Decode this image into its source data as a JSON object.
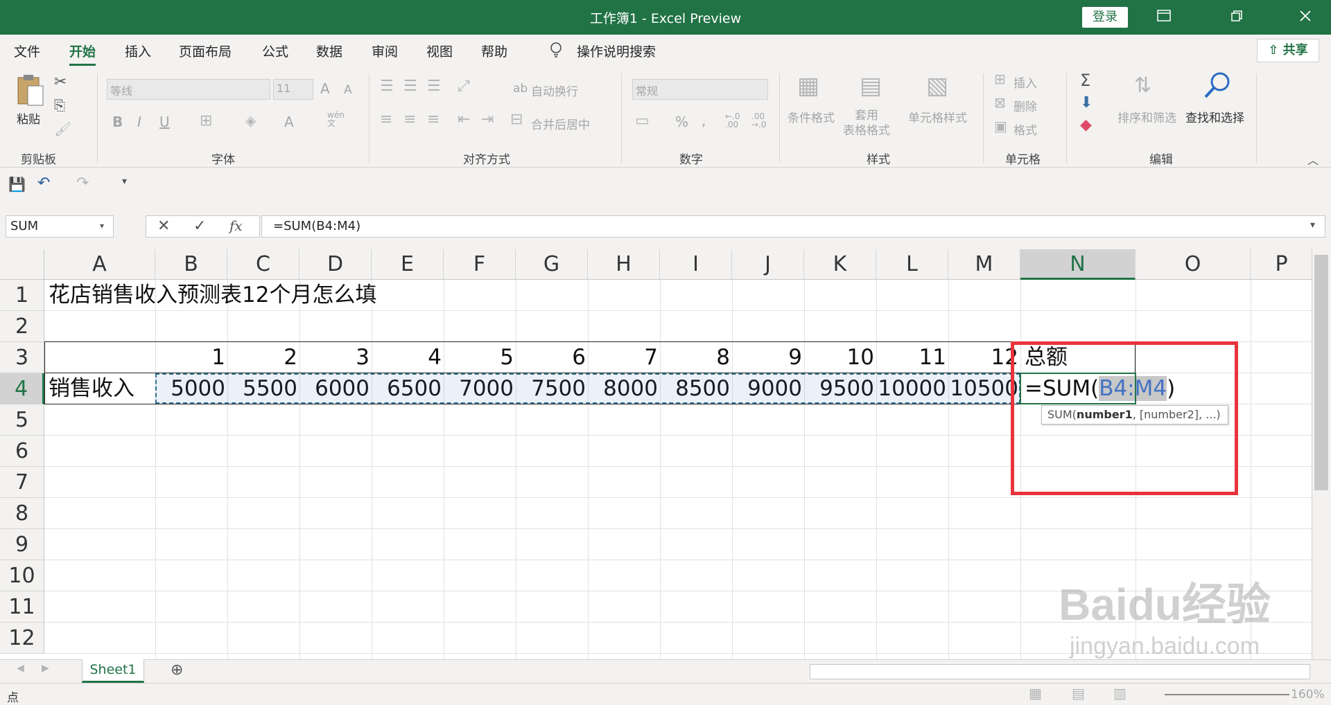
{
  "titlebar": {
    "title": "工作簿1  -  Excel Preview",
    "login": "登录",
    "ribbon_display_icon": "ribbon-display-icon",
    "restore_icon": "restore-icon",
    "close_icon": "close-icon"
  },
  "menu": {
    "tabs": [
      "文件",
      "开始",
      "插入",
      "页面布局",
      "公式",
      "数据",
      "审阅",
      "视图",
      "帮助"
    ],
    "active": "开始",
    "search": "操作说明搜索",
    "share": "共享"
  },
  "ribbon": {
    "clipboard": {
      "label": "剪贴板",
      "paste": "粘贴"
    },
    "font": {
      "label": "字体",
      "font_name": "等线",
      "font_size": "11",
      "bold": "B",
      "italic": "I",
      "underline": "U",
      "grow": "A",
      "shrink": "A",
      "wen": "wén\n文"
    },
    "alignment": {
      "label": "对齐方式",
      "wrap": "自动换行",
      "merge": "合并后居中"
    },
    "number": {
      "label": "数字",
      "format": "常规",
      "percent": "%",
      "comma": ",",
      "inc": "←.0\n.00",
      "dec": ".00\n→.0"
    },
    "styles": {
      "label": "样式",
      "conditional": "条件格式",
      "table": "套用\n表格格式",
      "cell_styles": "单元格样式"
    },
    "cells": {
      "label": "单元格",
      "insert": "插入",
      "delete": "删除",
      "format": "格式"
    },
    "editing": {
      "label": "编辑",
      "sort": "排序和筛选",
      "find": "查找和选择"
    }
  },
  "formula_bar": {
    "name_box": "SUM",
    "formula": "=SUM(B4:M4)",
    "fx": "fx"
  },
  "columns": [
    "A",
    "B",
    "C",
    "D",
    "E",
    "F",
    "G",
    "H",
    "I",
    "J",
    "K",
    "L",
    "M",
    "N",
    "O",
    "P"
  ],
  "rows": [
    "1",
    "2",
    "3",
    "4",
    "5",
    "6",
    "7",
    "8",
    "9",
    "10",
    "11",
    "12"
  ],
  "cells": {
    "a1": "花店销售收入预测表12个月怎么填",
    "months": [
      "1",
      "2",
      "3",
      "4",
      "5",
      "6",
      "7",
      "8",
      "9",
      "10",
      "11",
      "12"
    ],
    "n3": "总额",
    "a4": "销售收入",
    "sales": [
      "5000",
      "5500",
      "6000",
      "6500",
      "7000",
      "7500",
      "8000",
      "8500",
      "9000",
      "9500",
      "10000",
      "10500"
    ],
    "n4_prefix": "=SUM(",
    "n4_ref": "B4:M4",
    "n4_suffix": ")"
  },
  "tooltip": {
    "prefix": "SUM(",
    "bold": "number1",
    "suffix": ", [number2], ...)"
  },
  "sheet_tab": "Sheet1",
  "status": {
    "mode": "点",
    "zoom": "160%"
  },
  "watermark": {
    "text1": "Baidu经验",
    "text2": "jingyan.baidu.com"
  },
  "colors": {
    "excel_green": "#217346",
    "highlight_red": "#e8333c",
    "range_blue": "#4472c4"
  }
}
